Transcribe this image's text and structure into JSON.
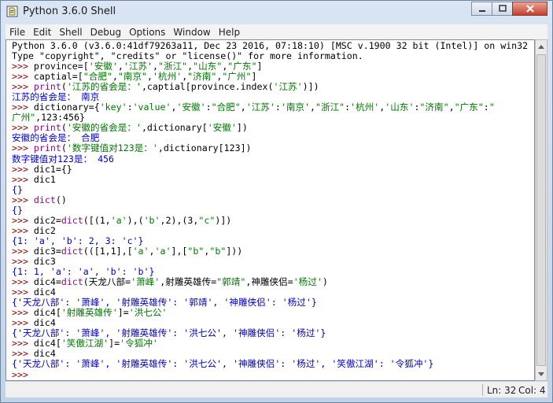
{
  "window": {
    "title": "Python 3.6.0 Shell"
  },
  "menu": [
    "File",
    "Edit",
    "Shell",
    "Debug",
    "Options",
    "Window",
    "Help"
  ],
  "colors": {
    "prompt": "#8b0000",
    "output": "#0000cc",
    "string": "#007800",
    "builtin": "#8b0a8b",
    "code": "#000000"
  },
  "lines": [
    [
      {
        "t": "Python 3.6.0 (v3.6.0:41df79263a11, Dec 23 2016, 07:18:10) [MSC v.1900 32 bit (Intel)] on win32",
        "c": "code"
      }
    ],
    [
      {
        "t": "Type \"copyright\", \"credits\" or \"license()\" for more information.",
        "c": "code"
      }
    ],
    [
      {
        "t": ">>> ",
        "c": "prompt"
      },
      {
        "t": "province=[",
        "c": "code"
      },
      {
        "t": "'安徽'",
        "c": "string"
      },
      {
        "t": ",",
        "c": "code"
      },
      {
        "t": "'江苏'",
        "c": "string"
      },
      {
        "t": ",",
        "c": "code"
      },
      {
        "t": "\"浙江\"",
        "c": "string"
      },
      {
        "t": ",",
        "c": "code"
      },
      {
        "t": "\"山东\"",
        "c": "string"
      },
      {
        "t": ",",
        "c": "code"
      },
      {
        "t": "\"广东\"",
        "c": "string"
      },
      {
        "t": "]",
        "c": "code"
      }
    ],
    [
      {
        "t": ">>> ",
        "c": "prompt"
      },
      {
        "t": "captial=[",
        "c": "code"
      },
      {
        "t": "\"合肥\"",
        "c": "string"
      },
      {
        "t": ",",
        "c": "code"
      },
      {
        "t": "\"南京\"",
        "c": "string"
      },
      {
        "t": ",",
        "c": "code"
      },
      {
        "t": "'杭州'",
        "c": "string"
      },
      {
        "t": ",",
        "c": "code"
      },
      {
        "t": "\"济南\"",
        "c": "string"
      },
      {
        "t": ",",
        "c": "code"
      },
      {
        "t": "\"广州\"",
        "c": "string"
      },
      {
        "t": "]",
        "c": "code"
      }
    ],
    [
      {
        "t": ">>> ",
        "c": "prompt"
      },
      {
        "t": "print",
        "c": "builtin"
      },
      {
        "t": "(",
        "c": "code"
      },
      {
        "t": "'江苏的省会是：'",
        "c": "string"
      },
      {
        "t": ",captial[province.index(",
        "c": "code"
      },
      {
        "t": "'江苏'",
        "c": "string"
      },
      {
        "t": ")])",
        "c": "code"
      }
    ],
    [
      {
        "t": "江苏的省会是： 南京",
        "c": "output"
      }
    ],
    [
      {
        "t": ">>> ",
        "c": "prompt"
      },
      {
        "t": "dictionary={",
        "c": "code"
      },
      {
        "t": "'key'",
        "c": "string"
      },
      {
        "t": ":",
        "c": "code"
      },
      {
        "t": "'value'",
        "c": "string"
      },
      {
        "t": ",",
        "c": "code"
      },
      {
        "t": "'安徽'",
        "c": "string"
      },
      {
        "t": ":",
        "c": "code"
      },
      {
        "t": "\"合肥\"",
        "c": "string"
      },
      {
        "t": ",",
        "c": "code"
      },
      {
        "t": "'江苏'",
        "c": "string"
      },
      {
        "t": ":",
        "c": "code"
      },
      {
        "t": "'南京'",
        "c": "string"
      },
      {
        "t": ",",
        "c": "code"
      },
      {
        "t": "\"浙江\"",
        "c": "string"
      },
      {
        "t": ":",
        "c": "code"
      },
      {
        "t": "'杭州'",
        "c": "string"
      },
      {
        "t": ",",
        "c": "code"
      },
      {
        "t": "'山东'",
        "c": "string"
      },
      {
        "t": ":",
        "c": "code"
      },
      {
        "t": "\"济南\"",
        "c": "string"
      },
      {
        "t": ",",
        "c": "code"
      },
      {
        "t": "\"广东\"",
        "c": "string"
      },
      {
        "t": ":",
        "c": "code"
      },
      {
        "t": "\"",
        "c": "string"
      }
    ],
    [
      {
        "t": "广州\"",
        "c": "string"
      },
      {
        "t": ",123:456}",
        "c": "code"
      }
    ],
    [
      {
        "t": ">>> ",
        "c": "prompt"
      },
      {
        "t": "print",
        "c": "builtin"
      },
      {
        "t": "(",
        "c": "code"
      },
      {
        "t": "'安徽的省会是：'",
        "c": "string"
      },
      {
        "t": ",dictionary[",
        "c": "code"
      },
      {
        "t": "'安徽'",
        "c": "string"
      },
      {
        "t": "])",
        "c": "code"
      }
    ],
    [
      {
        "t": "安徽的省会是： 合肥",
        "c": "output"
      }
    ],
    [
      {
        "t": ">>> ",
        "c": "prompt"
      },
      {
        "t": "print",
        "c": "builtin"
      },
      {
        "t": "(",
        "c": "code"
      },
      {
        "t": "'数字键值对123是：'",
        "c": "string"
      },
      {
        "t": ",dictionary[123])",
        "c": "code"
      }
    ],
    [
      {
        "t": "数字键值对123是： 456",
        "c": "output"
      }
    ],
    [
      {
        "t": ">>> ",
        "c": "prompt"
      },
      {
        "t": "dic1={}",
        "c": "code"
      }
    ],
    [
      {
        "t": ">>> ",
        "c": "prompt"
      },
      {
        "t": "dic1",
        "c": "code"
      }
    ],
    [
      {
        "t": "{}",
        "c": "output"
      }
    ],
    [
      {
        "t": ">>> ",
        "c": "prompt"
      },
      {
        "t": "dict",
        "c": "builtin"
      },
      {
        "t": "()",
        "c": "code"
      }
    ],
    [
      {
        "t": "{}",
        "c": "output"
      }
    ],
    [
      {
        "t": ">>> ",
        "c": "prompt"
      },
      {
        "t": "dic2=",
        "c": "code"
      },
      {
        "t": "dict",
        "c": "builtin"
      },
      {
        "t": "([(1,",
        "c": "code"
      },
      {
        "t": "'a'",
        "c": "string"
      },
      {
        "t": "),(",
        "c": "code"
      },
      {
        "t": "'b'",
        "c": "string"
      },
      {
        "t": ",2),(3,",
        "c": "code"
      },
      {
        "t": "\"c\"",
        "c": "string"
      },
      {
        "t": ")])",
        "c": "code"
      }
    ],
    [
      {
        "t": ">>> ",
        "c": "prompt"
      },
      {
        "t": "dic2",
        "c": "code"
      }
    ],
    [
      {
        "t": "{1: 'a', 'b': 2, 3: 'c'}",
        "c": "output"
      }
    ],
    [
      {
        "t": ">>> ",
        "c": "prompt"
      },
      {
        "t": "dic3=",
        "c": "code"
      },
      {
        "t": "dict",
        "c": "builtin"
      },
      {
        "t": "(([1,1],[",
        "c": "code"
      },
      {
        "t": "'a'",
        "c": "string"
      },
      {
        "t": ",",
        "c": "code"
      },
      {
        "t": "'a'",
        "c": "string"
      },
      {
        "t": "],[",
        "c": "code"
      },
      {
        "t": "\"b\"",
        "c": "string"
      },
      {
        "t": ",",
        "c": "code"
      },
      {
        "t": "\"b\"",
        "c": "string"
      },
      {
        "t": "]))",
        "c": "code"
      }
    ],
    [
      {
        "t": ">>> ",
        "c": "prompt"
      },
      {
        "t": "dic3",
        "c": "code"
      }
    ],
    [
      {
        "t": "{1: 1, 'a': 'a', 'b': 'b'}",
        "c": "output"
      }
    ],
    [
      {
        "t": ">>> ",
        "c": "prompt"
      },
      {
        "t": "dic4=",
        "c": "code"
      },
      {
        "t": "dict",
        "c": "builtin"
      },
      {
        "t": "(天龙八部=",
        "c": "code"
      },
      {
        "t": "'萧峰'",
        "c": "string"
      },
      {
        "t": ",射雕英雄传=",
        "c": "code"
      },
      {
        "t": "\"郭靖\"",
        "c": "string"
      },
      {
        "t": ",神雕侠侣=",
        "c": "code"
      },
      {
        "t": "'杨过'",
        "c": "string"
      },
      {
        "t": ")",
        "c": "code"
      }
    ],
    [
      {
        "t": ">>> ",
        "c": "prompt"
      },
      {
        "t": "dic4",
        "c": "code"
      }
    ],
    [
      {
        "t": "{'天龙八部': '萧峰', '射雕英雄传': '郭靖', '神雕侠侣': '杨过'}",
        "c": "output"
      }
    ],
    [
      {
        "t": ">>> ",
        "c": "prompt"
      },
      {
        "t": "dic4[",
        "c": "code"
      },
      {
        "t": "'射雕英雄传'",
        "c": "string"
      },
      {
        "t": "]=",
        "c": "code"
      },
      {
        "t": "'洪七公'",
        "c": "string"
      }
    ],
    [
      {
        "t": ">>> ",
        "c": "prompt"
      },
      {
        "t": "dic4",
        "c": "code"
      }
    ],
    [
      {
        "t": "{'天龙八部': '萧峰', '射雕英雄传': '洪七公', '神雕侠侣': '杨过'}",
        "c": "output"
      }
    ],
    [
      {
        "t": ">>> ",
        "c": "prompt"
      },
      {
        "t": "dic4[",
        "c": "code"
      },
      {
        "t": "'笑傲江湖'",
        "c": "string"
      },
      {
        "t": "]=",
        "c": "code"
      },
      {
        "t": "'令狐冲'",
        "c": "string"
      }
    ],
    [
      {
        "t": ">>> ",
        "c": "prompt"
      },
      {
        "t": "dic4",
        "c": "code"
      }
    ],
    [
      {
        "t": "{'天龙八部': '萧峰', '射雕英雄传': '洪七公', '神雕侠侣': '杨过', '笑傲江湖': '令狐冲'}",
        "c": "output"
      }
    ],
    [
      {
        "t": ">>> ",
        "c": "prompt"
      }
    ]
  ],
  "status": {
    "ln": "Ln: 32",
    "col": "Col: 4"
  },
  "icons": {
    "app": "python-idle-icon",
    "minimize": "minimize-icon",
    "maximize": "maximize-icon",
    "close": "close-icon"
  }
}
